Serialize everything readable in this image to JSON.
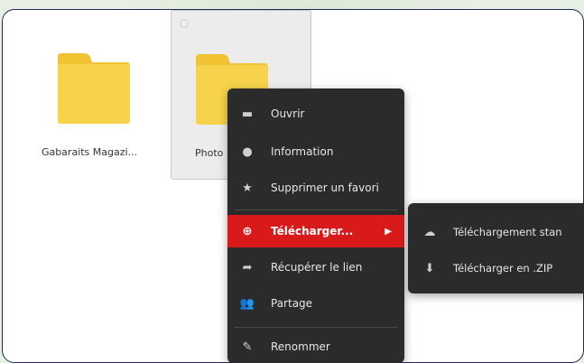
{
  "folders": [
    {
      "label": "Gabaraits Magazi..."
    },
    {
      "label": "Photo"
    }
  ],
  "context_menu": {
    "items": [
      {
        "icon": "folder-open-icon",
        "label": "Ouvrir"
      },
      {
        "icon": "info-icon",
        "label": "Information"
      },
      {
        "icon": "star-icon",
        "label": "Supprimer un favori"
      },
      {
        "icon": "download-plus-icon",
        "label": "Télécharger..."
      },
      {
        "icon": "share-arrow-icon",
        "label": "Récupérer le lien"
      },
      {
        "icon": "users-icon",
        "label": "Partage"
      },
      {
        "icon": "pencil-icon",
        "label": "Renommer"
      }
    ],
    "active_color": "#d91a1a"
  },
  "submenu": {
    "items": [
      {
        "icon": "cloud-download-icon",
        "label": "Téléchargement stan"
      },
      {
        "icon": "zip-download-icon",
        "label": "Télécharger en .ZIP"
      }
    ]
  },
  "colors": {
    "folder": "#f6d34a",
    "menu_bg": "#2b2b2b",
    "frame_border": "#1f2a5a"
  }
}
